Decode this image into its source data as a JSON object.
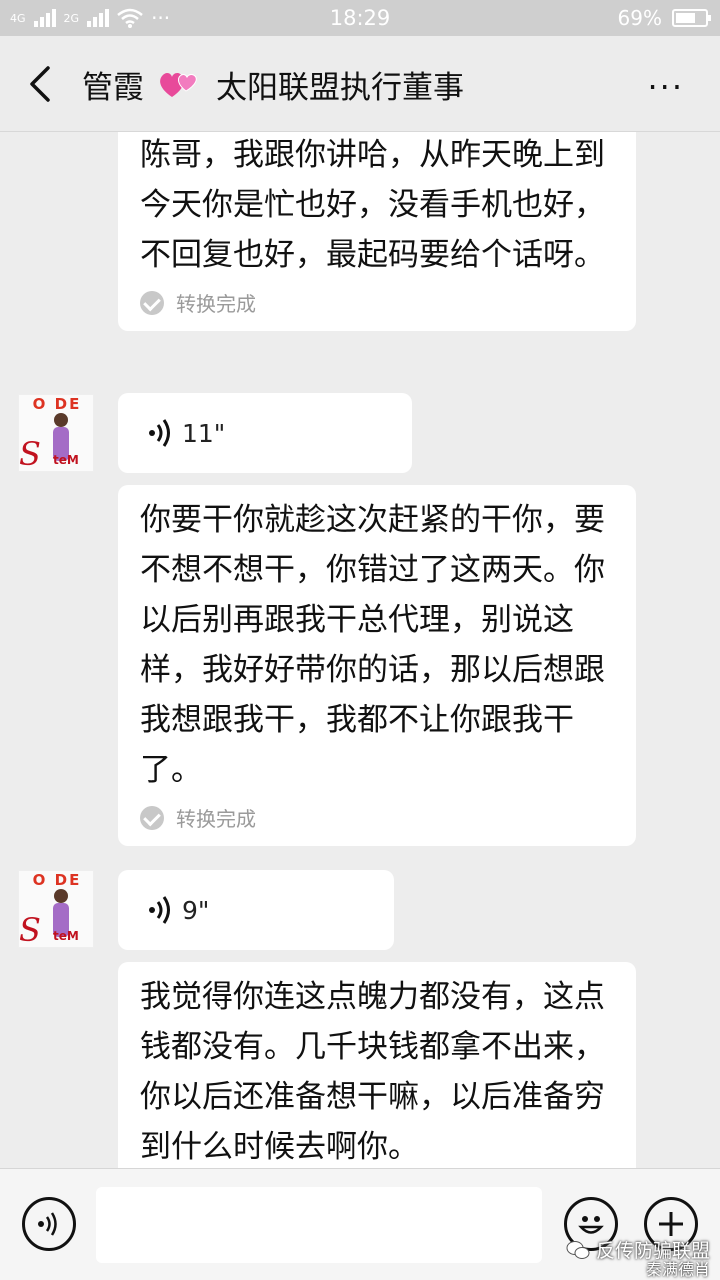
{
  "status_bar": {
    "network_1": "4G",
    "network_2": "2G",
    "dots": "···",
    "time": "18:29",
    "battery_text": "69%",
    "battery_level": 0.69
  },
  "header": {
    "contact_name": "管霞",
    "contact_title": "太阳联盟执行董事",
    "more_label": "···",
    "heart_icon": "two-hearts-icon"
  },
  "messages": [
    {
      "type": "text",
      "text": "陈哥，我跟你讲哈，从昨天晚上到今天你是忙也好，没看手机也好，不回复也好，最起码要给个话呀。",
      "status": "转换完成"
    },
    {
      "type": "voice",
      "duration": "11\""
    },
    {
      "type": "text",
      "text": "你要干你就趁这次赶紧的干你，要不想不想干，你错过了这两天。你以后别再跟我干总代理，别说这样，我好好带你的话，那以后想跟我想跟我干，我都不让你跟我干了。",
      "status": "转换完成"
    },
    {
      "type": "voice",
      "duration": "9\""
    },
    {
      "type": "text",
      "text": "我觉得你连这点魄力都没有，这点钱都没有。几千块钱都拿不出来，你以后还准备想干嘛，以后准备穷到什么时候去啊你。"
    }
  ],
  "avatar": {
    "top_text": "O DE",
    "letter": "S",
    "tail_text": "teM"
  },
  "input": {
    "placeholder": ""
  },
  "watermark": {
    "line1": "反传防骗联盟",
    "line2": "秦满德肖"
  },
  "colors": {
    "status_bar_bg": "#cfcfcf",
    "header_bg": "#ececec",
    "chat_bg": "#ededed",
    "bubble_bg": "#ffffff",
    "muted": "#9a9a9a"
  }
}
